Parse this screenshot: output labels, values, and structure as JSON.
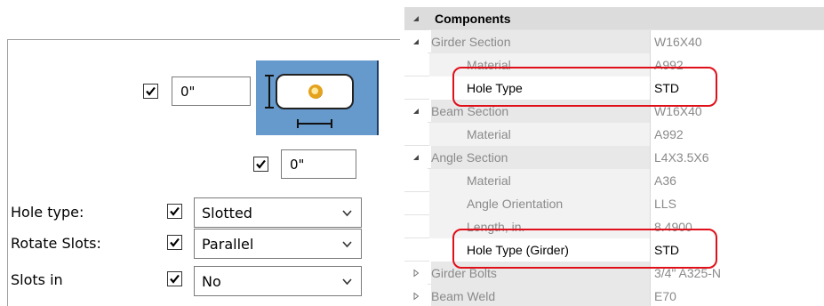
{
  "left_panel": {
    "top_offset_value": "0\"",
    "bottom_offset_value": "0\"",
    "top_offset_checked": true,
    "bottom_offset_checked": true,
    "fields": [
      {
        "label": "Hole type:",
        "value": "Slotted",
        "checked": true
      },
      {
        "label": "Rotate Slots:",
        "value": "Parallel",
        "checked": true
      },
      {
        "label": "Slots in",
        "value": "No",
        "checked": true
      }
    ]
  },
  "property_grid": {
    "rows": [
      {
        "kind": "category",
        "name": "Components",
        "value": "",
        "expand": "collapse"
      },
      {
        "kind": "sub",
        "name": "Girder Section",
        "value": "W16X40",
        "expand": "collapse"
      },
      {
        "kind": "leaf",
        "name": "Material",
        "value": "A992"
      },
      {
        "kind": "leaf",
        "name": "Hole Type",
        "value": "STD",
        "highlight": true
      },
      {
        "kind": "sub",
        "name": "Beam Section",
        "value": "W16X40",
        "expand": "collapse"
      },
      {
        "kind": "leaf",
        "name": "Material",
        "value": "A992"
      },
      {
        "kind": "sub",
        "name": "Angle Section",
        "value": "L4X3.5X6",
        "expand": "collapse"
      },
      {
        "kind": "leaf",
        "name": "Material",
        "value": "A36"
      },
      {
        "kind": "leaf",
        "name": "Angle Orientation",
        "value": "LLS"
      },
      {
        "kind": "leaf",
        "name": "Length, in.",
        "value": "8.4900"
      },
      {
        "kind": "leaf",
        "name": "Hole Type (Girder)",
        "value": "STD",
        "highlight": true
      },
      {
        "kind": "sub",
        "name": "Girder Bolts",
        "value": "3/4\" A325-N",
        "expand": "expand"
      },
      {
        "kind": "sub",
        "name": "Beam Weld",
        "value": "E70",
        "expand": "expand"
      }
    ]
  },
  "colors": {
    "preview_background": "#6699cc",
    "highlight_ring": "#e0101a",
    "category_background": "#dcdcdc"
  },
  "icons": {
    "collapse": "triangle-down-icon",
    "expand": "triangle-right-icon",
    "checkbox": "checkmark-icon",
    "dropdown": "chevron-down-icon",
    "preview": "slotted-hole-preview-icon"
  }
}
